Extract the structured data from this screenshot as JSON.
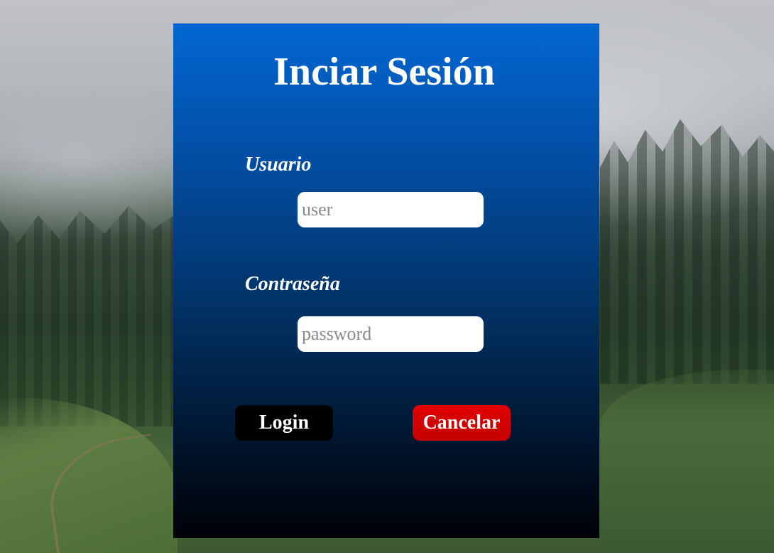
{
  "login": {
    "title": "Inciar Sesión",
    "username_label": "Usuario",
    "username_placeholder": "user",
    "username_value": "",
    "password_label": "Contraseña",
    "password_placeholder": "password",
    "password_value": "",
    "login_button": "Login",
    "cancel_button": "Cancelar"
  },
  "colors": {
    "panel_top": "#0267d1",
    "panel_bottom": "#000106",
    "login_button_bg": "#000000",
    "cancel_button_bg": "#e00000",
    "text": "#ffffff"
  }
}
